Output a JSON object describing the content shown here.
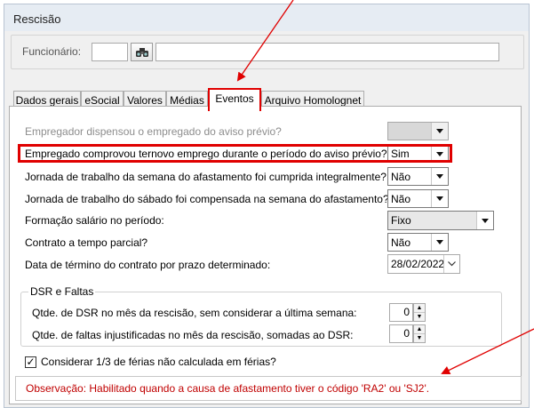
{
  "window": {
    "title": "Rescisão"
  },
  "funcionario": {
    "label": "Funcionário:",
    "code_value": "",
    "name_value": ""
  },
  "tabs": [
    {
      "label": "Dados gerais",
      "active": false
    },
    {
      "label": "eSocial",
      "active": false
    },
    {
      "label": "Valores",
      "active": false
    },
    {
      "label": "Médias",
      "active": false
    },
    {
      "label": "Eventos",
      "active": true
    },
    {
      "label": "Arquivo Homolognet",
      "active": false
    }
  ],
  "fields": {
    "dispensou": {
      "label": "Empregador dispensou o empregado do aviso prévio?",
      "value": "",
      "disabled": true
    },
    "novo_emprego": {
      "label": "Empregado comprovou ternovo emprego durante o período do aviso prévio?",
      "value": "Sim"
    },
    "jornada_semana": {
      "label": "Jornada de trabalho da semana do afastamento foi cumprida integralmente?",
      "value": "Não"
    },
    "jornada_sabado": {
      "label": "Jornada de trabalho do sábado foi compensada na semana do afastamento?",
      "value": "Não"
    },
    "formacao_salario": {
      "label": "Formação salário no período:",
      "value": "Fixo"
    },
    "tempo_parcial": {
      "label": "Contrato a tempo parcial?",
      "value": "Não"
    },
    "data_termino": {
      "label": "Data de término do contrato por prazo determinado:",
      "value": "28/02/2022"
    }
  },
  "dsr": {
    "title": "DSR e Faltas",
    "qtde_dsr": {
      "label": "Qtde. de DSR no mês da rescisão, sem considerar a última semana:",
      "value": "0"
    },
    "qtde_faltas": {
      "label": "Qtde. de faltas injustificadas no mês da rescisão, somadas ao DSR:",
      "value": "0"
    }
  },
  "ferias": {
    "label": "Considerar 1/3 de férias não calculada em férias?",
    "checked": true
  },
  "observacao": "Observação: Habilitado quando a causa de afastamento tiver o código 'RA2' ou 'SJ2'.",
  "colors": {
    "highlight": "#e00000",
    "observacao_text": "#c00000"
  }
}
